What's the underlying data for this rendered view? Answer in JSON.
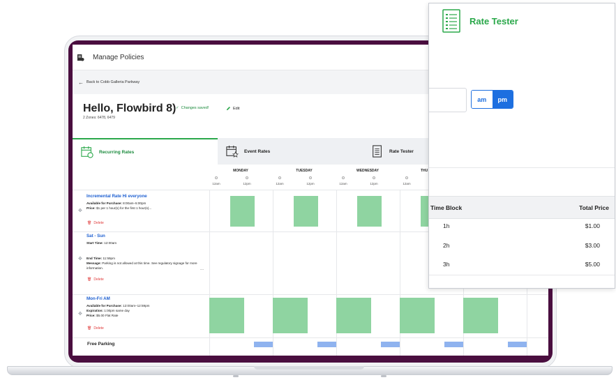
{
  "app": {
    "page_title": "Manage Policies",
    "back_link": "Back to Cobb Galleria Parkway",
    "heading": "Hello, Flowbird 8)",
    "saved_status": "Changes saved!",
    "edit_label": "Edit",
    "zones": "2 Zones: 6478, 6479"
  },
  "tabs": [
    {
      "label": "Recurring Rates",
      "icon": "calendar-repeat-icon",
      "active": true
    },
    {
      "label": "Event Rates",
      "icon": "calendar-star-icon",
      "active": false
    },
    {
      "label": "Rate Tester",
      "icon": "clipboard-list-icon",
      "active": false
    }
  ],
  "schedule": {
    "days": [
      "MONDAY",
      "TUESDAY",
      "WEDNESDAY",
      "THU"
    ],
    "ticks": [
      "12am",
      "12pm",
      "12am",
      "12pm",
      "12am",
      "12pm",
      "12am",
      "12pm"
    ]
  },
  "policies": [
    {
      "name": "Incremental Rate Hi everyone",
      "line1_label": "Available for Purchase:",
      "line1_value": " 8:00am–5:00pm",
      "line2_label": "Price:",
      "line2_value": " $1 per 1 hour(s) for the first 1 hour(s)...",
      "delete_label": "Delete"
    },
    {
      "name": "Sat - Sun",
      "line1_label": "Start Time:",
      "line1_value": " 12:00am",
      "line2_label": "End Time:",
      "line2_value": " 11:59pm",
      "line3_label": "Message:",
      "line3_value": " Parking is not allowed at this time. See regulatory signage for more information.",
      "ellipsis": "...",
      "delete_label": "Delete"
    },
    {
      "name": "Mon-Fri AM",
      "line1_label": "Available for Purchase:",
      "line1_value": " 12:00am–12:59pm",
      "line2_label": "Expiration:",
      "line2_value": " 1:00pm same day",
      "line3_label": "Price:",
      "line3_value": " $5.00 Flat Rate",
      "delete_label": "Delete"
    },
    {
      "name": "Free Parking"
    }
  ],
  "rate_tester": {
    "title": "Rate Tester",
    "am_label": "am",
    "pm_label": "pm",
    "selected": "pm",
    "col_time_block": "Time Block",
    "col_total_price": "Total Price",
    "rows": [
      {
        "time_block": "1h",
        "price": "$1.00"
      },
      {
        "time_block": "2h",
        "price": "$3.00"
      },
      {
        "time_block": "3h",
        "price": "$5.00"
      }
    ]
  },
  "colors": {
    "brand_green": "#2aa84a",
    "link_blue": "#1d5fd1",
    "delete_red": "#e03b3b",
    "block_green": "#8fd4a1",
    "block_blue": "#8fb3ef",
    "bezel": "#4a0e3f"
  }
}
